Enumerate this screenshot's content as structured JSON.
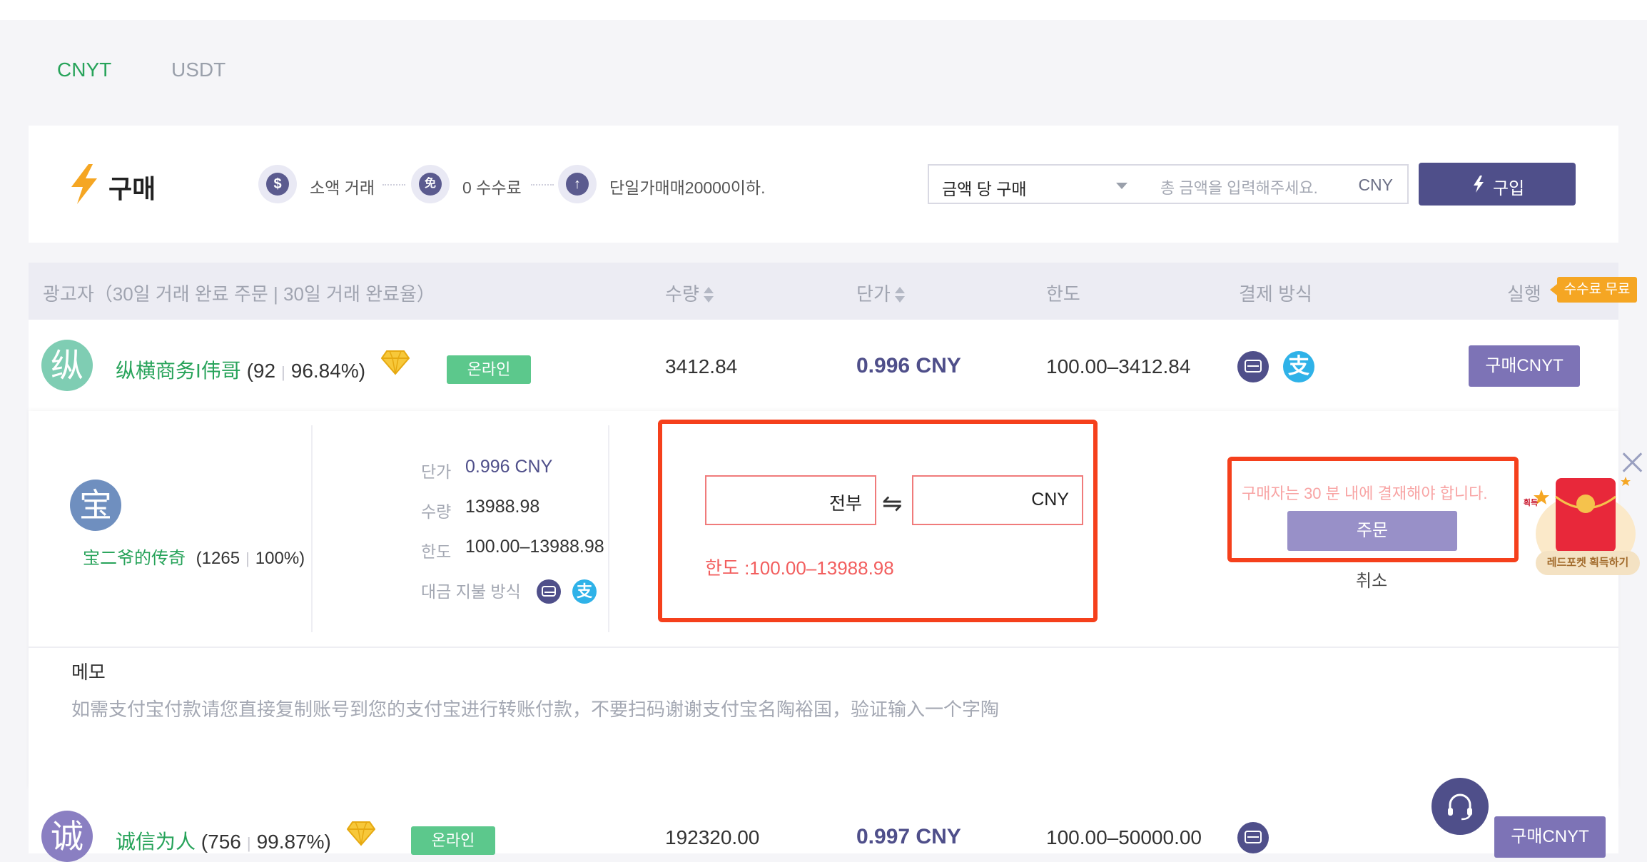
{
  "tabs": [
    {
      "label": "CNYT",
      "active": true
    },
    {
      "label": "USDT",
      "active": false
    }
  ],
  "buy_panel": {
    "title": "구매",
    "features": [
      {
        "icon": "dollar-icon",
        "glyph": "$",
        "label": "소액 거래"
      },
      {
        "icon": "free-icon",
        "glyph": "免",
        "label": "0 수수료"
      },
      {
        "icon": "limit-icon",
        "glyph": "↑",
        "label": "단일가매매20000이하."
      }
    ],
    "mode_select": "금액 당 구매",
    "amount_placeholder": "총 금액을 입력해주세요.",
    "amount_unit": "CNY",
    "buy_button": "구입"
  },
  "table": {
    "headers": {
      "advertiser": "광고자（30일 거래 완료 주문 | 30일 거래 완료율）",
      "quantity": "수량",
      "unit_price": "단가",
      "limit": "한도",
      "payment": "결제 방식",
      "action": "실행"
    },
    "fee_badge": "수수료 무료",
    "rows": [
      {
        "avatar_char": "纵",
        "name": "纵横商务I伟哥",
        "orders": "(92",
        "rate": "96.84%)",
        "status": "온라인",
        "quantity": "3412.84",
        "price": "0.996 CNY",
        "limit": "100.00–3412.84",
        "payments": [
          "card",
          "alipay"
        ],
        "action": "구매CNYT"
      },
      {
        "avatar_char": "诚",
        "name": "诚信为人",
        "orders": "(756",
        "rate": "99.87%)",
        "status": "온라인",
        "quantity": "192320.00",
        "price": "0.997 CNY",
        "limit": "100.00–50000.00",
        "payments": [
          "card"
        ],
        "action": "구매CNYT"
      }
    ]
  },
  "detail": {
    "avatar_char": "宝",
    "name": "宝二爷的传奇",
    "orders": "(1265",
    "rate": "100%)",
    "unit_price_label": "단가",
    "unit_price": "0.996 CNY",
    "quantity_label": "수량",
    "quantity": "13988.98",
    "limit_label": "한도",
    "limit": "100.00–13988.98",
    "payment_label": "대금 지불 방식",
    "input_all_suffix": "전부",
    "input_cny_suffix": "CNY",
    "swap_icon": "⇋",
    "limit_line": "한도 :100.00–13988.98",
    "warning": "구매자는 30 분 내에 결재해야 합니다.",
    "order_button": "주문",
    "cancel": "취소",
    "memo_title": "메모",
    "memo_text": "如需支付宝付款请您直接复制账号到您的支付宝进行转账付款，不要扫码谢谢支付宝名陶裕国，验证输入一个字陶"
  },
  "promo": {
    "label": "레드포켓 획득하기",
    "envelope_text": "획득"
  },
  "colors": {
    "accent": "#4f4f8a",
    "green": "#27a35a",
    "highlight_red": "#f5401c",
    "fee_orange": "#f5a623"
  }
}
